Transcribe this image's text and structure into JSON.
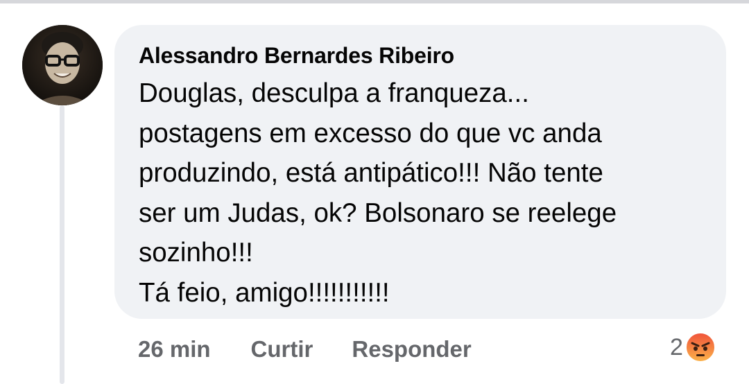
{
  "comment": {
    "author": "Alessandro Bernardes Ribeiro",
    "text": "Douglas, desculpa a franqueza...\npostagens em excesso do que vc anda\nproduzindo, está antipático!!! Não tente\nser um Judas, ok? Bolsonaro se reelege\nsozinho!!!\nTá feio, amigo!!!!!!!!!!!",
    "avatar_icon": "profile-photo"
  },
  "actions": {
    "time": "26 min",
    "like_label": "Curtir",
    "reply_label": "Responder"
  },
  "reactions": {
    "count": "2",
    "icon": "angry-reaction-icon",
    "colors": {
      "angry_top": "#f0523a",
      "angry_bottom": "#fbb34a"
    }
  }
}
